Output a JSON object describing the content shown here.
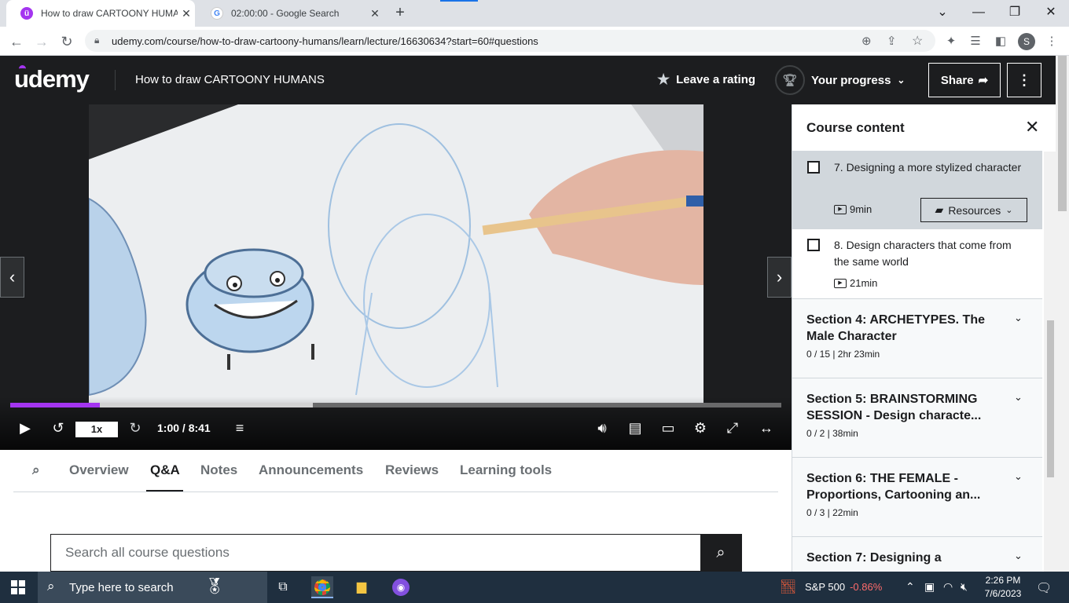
{
  "browser": {
    "tabs": [
      {
        "title": "How to draw CARTOONY HUMAN",
        "active": true
      },
      {
        "title": "02:00:00 - Google Search",
        "active": false
      }
    ],
    "url": "udemy.com/course/how-to-draw-cartoony-humans/learn/lecture/16630634?start=60#questions"
  },
  "header": {
    "logo": "udemy",
    "course_title": "How to draw CARTOONY HUMANS",
    "leave_rating": "Leave a rating",
    "progress_label": "Your progress",
    "share_label": "Share"
  },
  "player": {
    "speed": "1x",
    "timecode": "1:00 / 8:41",
    "played_fraction": 0.116,
    "buffered_fraction": 0.392
  },
  "lecture_tabs": [
    "Overview",
    "Q&A",
    "Notes",
    "Announcements",
    "Reviews",
    "Learning tools"
  ],
  "active_tab": "Q&A",
  "qa": {
    "search_placeholder": "Search all course questions"
  },
  "sidebar": {
    "title": "Course content",
    "lectures": [
      {
        "title": "7. Designing a more stylized character",
        "duration": "9min",
        "current": true,
        "resources": "Resources"
      },
      {
        "title": "8. Design characters that come from the same world",
        "duration": "21min",
        "current": false
      }
    ],
    "sections": [
      {
        "title": "Section 4: ARCHETYPES. The Male Character",
        "meta": "0 / 15 | 2hr 23min"
      },
      {
        "title": "Section 5: BRAINSTORMING SESSION - Design characte...",
        "meta": "0 / 2 | 38min"
      },
      {
        "title": "Section 6: THE FEMALE - Proportions, Cartooning an...",
        "meta": "0 / 3 | 22min"
      },
      {
        "title": "Section 7: Designing a",
        "meta": ""
      }
    ]
  },
  "taskbar": {
    "search_placeholder": "Type here to search",
    "stock_name": "S&P 500",
    "stock_change": "-0.86%",
    "time": "2:26 PM",
    "date": "7/6/2023"
  },
  "colors": {
    "udemy_purple": "#a435f0",
    "header_bg": "#1c1d1f",
    "taskbar_bg": "#1f2f3f"
  }
}
